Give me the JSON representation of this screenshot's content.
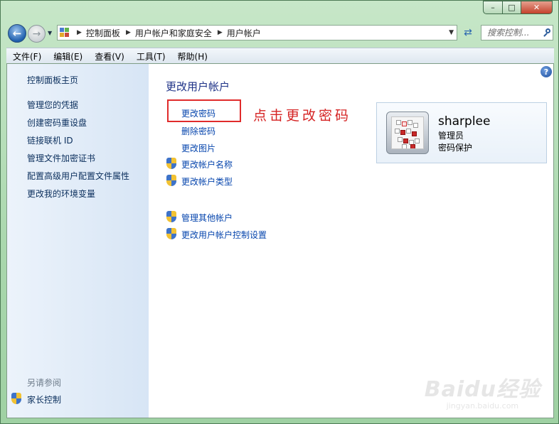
{
  "window": {
    "minimize_glyph": "–",
    "maximize_glyph": "□",
    "close_glyph": "✕"
  },
  "address_bar": {
    "crumbs": [
      "控制面板",
      "用户帐户和家庭安全",
      "用户帐户"
    ],
    "separator_glyph": "▶",
    "dropdown_glyph": "▼"
  },
  "search": {
    "placeholder": "搜索控制..."
  },
  "menu": {
    "items": [
      "文件(F)",
      "编辑(E)",
      "查看(V)",
      "工具(T)",
      "帮助(H)"
    ]
  },
  "sidebar": {
    "home": "控制面板主页",
    "links": [
      "管理您的凭据",
      "创建密码重设盘",
      "链接联机 ID",
      "管理文件加密证书",
      "配置高级用户配置文件属性",
      "更改我的环境变量"
    ],
    "see_also_label": "另请参阅",
    "see_also_links": [
      "家长控制"
    ]
  },
  "main": {
    "title": "更改用户帐户",
    "tasks": [
      "更改密码",
      "删除密码",
      "更改图片"
    ],
    "shield_tasks": [
      "更改帐户名称",
      "更改帐户类型"
    ],
    "other_tasks": [
      "管理其他帐户",
      "更改用户帐户控制设置"
    ]
  },
  "annotation": {
    "text": "点击更改密码",
    "color": "#d52323"
  },
  "user": {
    "name": "sharplee",
    "role": "管理员",
    "protection": "密码保护",
    "avatar_icon": "letter-tiles-avatar"
  },
  "watermark": {
    "logo": "Baidu经验",
    "url": "jingyan.baidu.com"
  },
  "colors": {
    "title_blue": "#1e3287",
    "link_blue": "#0645ad",
    "annotation_red": "#e02b2b"
  }
}
